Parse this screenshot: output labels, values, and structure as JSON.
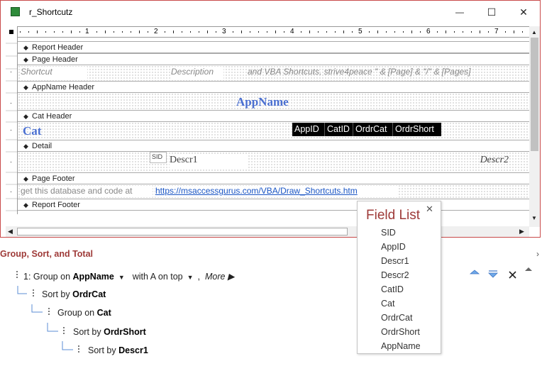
{
  "window": {
    "title": "r_Shortcutz",
    "minimize": "—",
    "maximize": "☐",
    "close": "✕"
  },
  "ruler": {
    "marks": [
      "1",
      "2",
      "3",
      "4",
      "5",
      "6",
      "7"
    ]
  },
  "sections": {
    "report_header": "Report Header",
    "page_header": "Page Header",
    "appname_header": "AppName Header",
    "cat_header": "Cat Header",
    "detail": "Detail",
    "page_footer": "Page Footer",
    "report_footer": "Report Footer"
  },
  "controls": {
    "shortcut": "Shortcut",
    "description": "Description",
    "page_expr": "and VBA Shortcuts, strive4peace \" & [Page] & \"/\" & [Pages]",
    "appname": "AppName",
    "cat": "Cat",
    "appid": "AppID",
    "catid": "CatID",
    "ordrcat": "OrdrCat",
    "ordrshort": "OrdrShort",
    "sid": "SID",
    "descr1": "Descr1",
    "descr2": "Descr2",
    "footer_text": "get this database and code at",
    "footer_link": "https://msaccessgurus.com/VBA/Draw_Shortcuts.htm"
  },
  "group_panel": {
    "title": "Group, Sort, and Total",
    "line1_prefix": "1:  Group on",
    "line1_field": "AppName",
    "line1_order": "with A on top",
    "line1_more": "More ▶",
    "line2_prefix": "Sort by",
    "line2_field": "OrdrCat",
    "line3_prefix": "Group on",
    "line3_field": "Cat",
    "line4_prefix": "Sort by",
    "line4_field": "OrdrShort",
    "line5_prefix": "Sort by",
    "line5_field": "Descr1"
  },
  "field_list": {
    "title": "Field List",
    "close": "✕",
    "items": [
      "SID",
      "AppID",
      "Descr1",
      "Descr2",
      "CatID",
      "Cat",
      "OrdrCat",
      "OrdrShort",
      "AppName"
    ]
  },
  "colors": {
    "accent": "#9e3a38",
    "appname_text": "#4a6fd1",
    "link": "#1a55c4",
    "black_box": "#000000"
  }
}
